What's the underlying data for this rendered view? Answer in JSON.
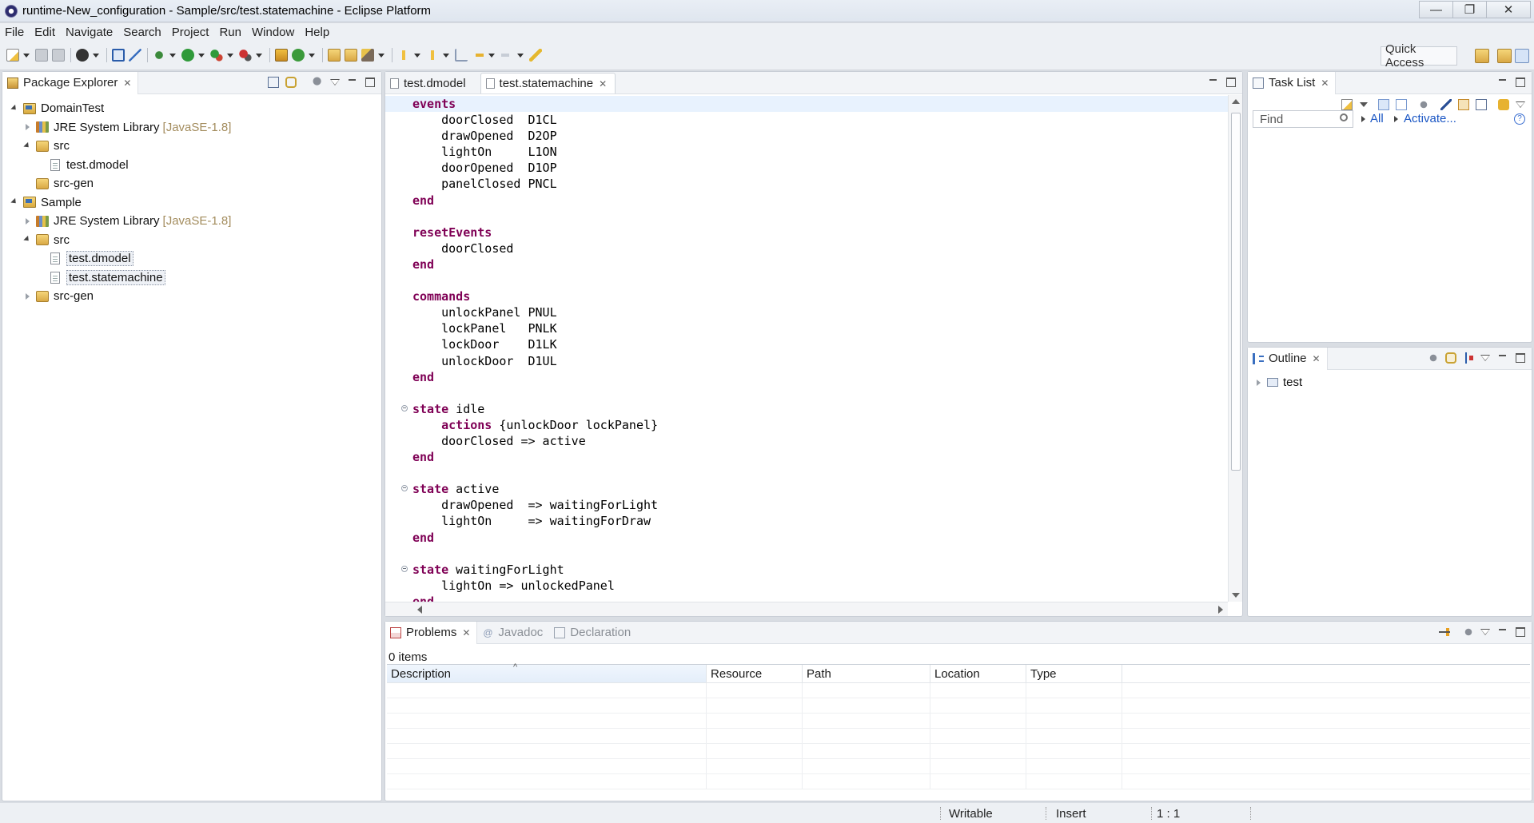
{
  "window": {
    "title": "runtime-New_configuration - Sample/src/test.statemachine - Eclipse Platform",
    "minimize": "—",
    "maximize": "❐",
    "close": "✕"
  },
  "menu": [
    "File",
    "Edit",
    "Navigate",
    "Search",
    "Project",
    "Run",
    "Window",
    "Help"
  ],
  "toolbar": {
    "quick_access": "Quick Access"
  },
  "package_explorer": {
    "title": "Package Explorer",
    "tree": [
      {
        "label": "DomainTest",
        "level": 0,
        "twisty": "expanded",
        "icon": "project-icon"
      },
      {
        "label": "JRE System Library",
        "note": "[JavaSE-1.8]",
        "level": 1,
        "twisty": "collapsed",
        "icon": "library-icon"
      },
      {
        "label": "src",
        "level": 1,
        "twisty": "expanded",
        "icon": "package-folder-icon"
      },
      {
        "label": "test.dmodel",
        "level": 2,
        "twisty": "none",
        "icon": "file-icon"
      },
      {
        "label": "src-gen",
        "level": 1,
        "twisty": "none",
        "icon": "package-folder-icon"
      },
      {
        "label": "Sample",
        "level": 0,
        "twisty": "expanded",
        "icon": "project-icon"
      },
      {
        "label": "JRE System Library",
        "note": "[JavaSE-1.8]",
        "level": 1,
        "twisty": "collapsed",
        "icon": "library-icon"
      },
      {
        "label": "src",
        "level": 1,
        "twisty": "expanded",
        "icon": "package-folder-icon"
      },
      {
        "label": "test.dmodel",
        "level": 2,
        "twisty": "none",
        "icon": "file-icon",
        "selected": true
      },
      {
        "label": "test.statemachine",
        "level": 2,
        "twisty": "none",
        "icon": "file-icon",
        "selected": true
      },
      {
        "label": "src-gen",
        "level": 1,
        "twisty": "collapsed",
        "icon": "package-folder-icon"
      }
    ]
  },
  "editor": {
    "tabs": [
      {
        "label": "test.dmodel",
        "active": false
      },
      {
        "label": "test.statemachine",
        "active": true
      }
    ],
    "lines": [
      {
        "kw": "events",
        "rest": ""
      },
      {
        "kw": "",
        "rest": "    doorClosed  D1CL"
      },
      {
        "kw": "",
        "rest": "    drawOpened  D2OP"
      },
      {
        "kw": "",
        "rest": "    lightOn     L1ON"
      },
      {
        "kw": "",
        "rest": "    doorOpened  D1OP"
      },
      {
        "kw": "",
        "rest": "    panelClosed PNCL"
      },
      {
        "kw": "end",
        "rest": ""
      },
      {
        "kw": "",
        "rest": ""
      },
      {
        "kw": "resetEvents",
        "rest": ""
      },
      {
        "kw": "",
        "rest": "    doorClosed"
      },
      {
        "kw": "end",
        "rest": ""
      },
      {
        "kw": "",
        "rest": ""
      },
      {
        "kw": "commands",
        "rest": ""
      },
      {
        "kw": "",
        "rest": "    unlockPanel PNUL"
      },
      {
        "kw": "",
        "rest": "    lockPanel   PNLK"
      },
      {
        "kw": "",
        "rest": "    lockDoor    D1LK"
      },
      {
        "kw": "",
        "rest": "    unlockDoor  D1UL"
      },
      {
        "kw": "end",
        "rest": ""
      },
      {
        "kw": "",
        "rest": ""
      },
      {
        "kw": "state",
        "rest": " idle",
        "fold": true
      },
      {
        "kw": "",
        "kw2": "    actions",
        "rest": " {unlockDoor lockPanel}"
      },
      {
        "kw": "",
        "rest": "    doorClosed => active"
      },
      {
        "kw": "end",
        "rest": ""
      },
      {
        "kw": "",
        "rest": ""
      },
      {
        "kw": "state",
        "rest": " active",
        "fold": true
      },
      {
        "kw": "",
        "rest": "    drawOpened  => waitingForLight"
      },
      {
        "kw": "",
        "rest": "    lightOn     => waitingForDraw"
      },
      {
        "kw": "end",
        "rest": ""
      },
      {
        "kw": "",
        "rest": ""
      },
      {
        "kw": "state",
        "rest": " waitingForLight",
        "fold": true
      },
      {
        "kw": "",
        "rest": "    lightOn => unlockedPanel"
      },
      {
        "kw": "end",
        "rest": ""
      }
    ]
  },
  "task_list": {
    "title": "Task List",
    "find_placeholder": "Find",
    "all_label": "All",
    "activate_label": "Activate...",
    "help": "?"
  },
  "outline": {
    "title": "Outline",
    "items": [
      {
        "label": "test"
      }
    ]
  },
  "bottom_panel": {
    "tabs": [
      {
        "label": "Problems",
        "active": true
      },
      {
        "label": "Javadoc",
        "active": false
      },
      {
        "label": "Declaration",
        "active": false
      }
    ],
    "count": "0 items",
    "columns": [
      "Description",
      "Resource",
      "Path",
      "Location",
      "Type"
    ],
    "sort_indicator": "^"
  },
  "status": {
    "writable": "Writable",
    "insert_mode": "Insert",
    "position": "1 : 1"
  },
  "colors": {
    "keyword": "#7f0055",
    "link": "#1a56c4",
    "current_line": "#e8f2fe",
    "library_note": "#a38c5d"
  }
}
